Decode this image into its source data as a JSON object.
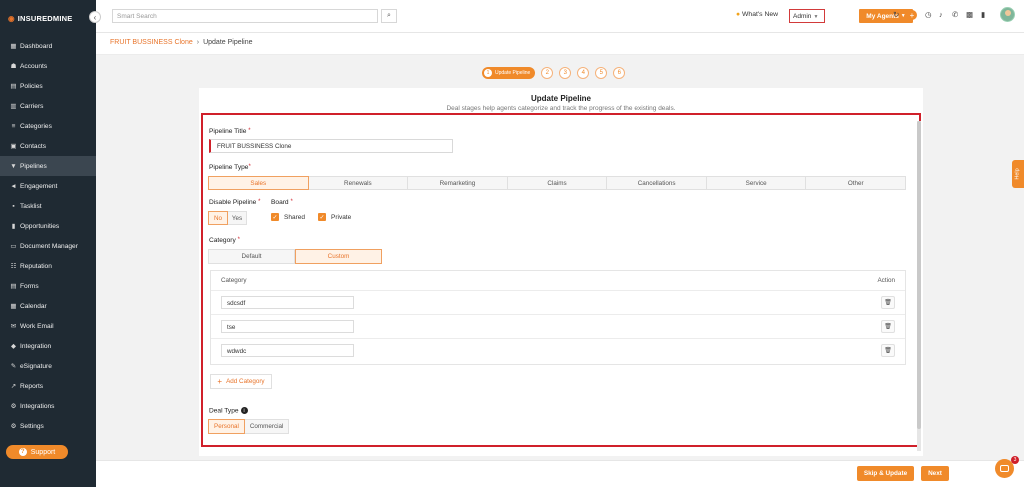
{
  "brand": {
    "name": "INSUREDMINE"
  },
  "sidebar": {
    "items": [
      {
        "label": "Dashboard",
        "icon": "dashboard-icon",
        "glyph": "▦"
      },
      {
        "label": "Accounts",
        "icon": "accounts-icon",
        "glyph": "☗"
      },
      {
        "label": "Policies",
        "icon": "policies-icon",
        "glyph": "▤"
      },
      {
        "label": "Carriers",
        "icon": "carriers-icon",
        "glyph": "▥"
      },
      {
        "label": "Categories",
        "icon": "categories-icon",
        "glyph": "≡"
      },
      {
        "label": "Contacts",
        "icon": "contacts-icon",
        "glyph": "▣"
      },
      {
        "label": "Pipelines",
        "icon": "pipelines-icon",
        "glyph": "▼"
      },
      {
        "label": "Engagement",
        "icon": "engagement-icon",
        "glyph": "◄"
      },
      {
        "label": "Tasklist",
        "icon": "tasklist-icon",
        "glyph": "▪"
      },
      {
        "label": "Opportunities",
        "icon": "opportunities-icon",
        "glyph": "▮"
      },
      {
        "label": "Document Manager",
        "icon": "document-icon",
        "glyph": "▭"
      },
      {
        "label": "Reputation",
        "icon": "reputation-icon",
        "glyph": "☷"
      },
      {
        "label": "Forms",
        "icon": "forms-icon",
        "glyph": "▤"
      },
      {
        "label": "Calendar",
        "icon": "calendar-icon",
        "glyph": "▦"
      },
      {
        "label": "Work Email",
        "icon": "email-icon",
        "glyph": "✉"
      },
      {
        "label": "Integration",
        "icon": "integration-icon",
        "glyph": "◆"
      },
      {
        "label": "eSignature",
        "icon": "esignature-icon",
        "glyph": "✎"
      },
      {
        "label": "Reports",
        "icon": "reports-icon",
        "glyph": "↗"
      },
      {
        "label": "Integrations",
        "icon": "integrations-icon",
        "glyph": "⚙"
      },
      {
        "label": "Settings",
        "icon": "settings-icon",
        "glyph": "⚙"
      }
    ],
    "active_index": 6,
    "support_label": "Support"
  },
  "topbar": {
    "search_placeholder": "Smart Search",
    "whats_new": "What's New",
    "admin_select": "Admin",
    "agents_button": "My Agents"
  },
  "breadcrumb": {
    "parent": "FRUIT BUSSINESS Clone",
    "current": "Update Pipeline"
  },
  "stepper": {
    "active_label": "Update Pipeline",
    "active_number": "1",
    "steps": [
      "2",
      "3",
      "4",
      "5",
      "6"
    ]
  },
  "card": {
    "title": "Update Pipeline",
    "subtitle": "Deal stages help agents categorize and track the progress of the existing deals."
  },
  "form": {
    "pipeline_title_label": "Pipeline Title",
    "pipeline_title_value": "FRUIT BUSSINESS  Clone",
    "pipeline_type_label": "Pipeline Type",
    "pipeline_types": [
      "Sales",
      "Renewals",
      "Remarketing",
      "Claims",
      "Cancellations",
      "Service",
      "Other"
    ],
    "pipeline_type_selected": 0,
    "disable_label": "Disable Pipeline",
    "disable_options": [
      "No",
      "Yes"
    ],
    "board_label": "Board",
    "board_shared": "Shared",
    "board_private": "Private",
    "category_label": "Category",
    "category_options": [
      "Default",
      "Custom"
    ],
    "table": {
      "col_category": "Category",
      "col_action": "Action",
      "rows": [
        "sdcsdf",
        "tse",
        "wdwdc"
      ]
    },
    "add_category": "Add Category",
    "deal_type_label": "Deal Type",
    "deal_types": [
      "Personal",
      "Commercial"
    ]
  },
  "footer": {
    "skip_update": "Skip & Update",
    "next": "Next"
  },
  "help_tab": "Help",
  "chat_badge": "3",
  "colors": {
    "accent": "#f08a2a",
    "sidebar_bg": "#1f2a33",
    "highlight": "#d0202a"
  }
}
